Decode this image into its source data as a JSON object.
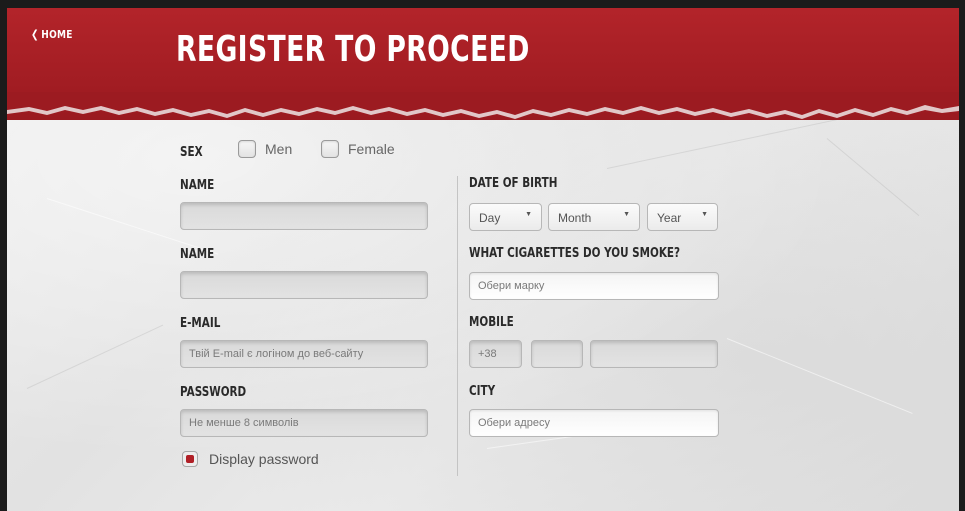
{
  "header": {
    "home_label": "HOME",
    "title": "REGISTER TO PROCEED"
  },
  "form": {
    "sex": {
      "label": "SEX",
      "options": [
        "Men",
        "Female"
      ]
    },
    "name_first": {
      "label": "NAME",
      "value": ""
    },
    "name_second": {
      "label": "NAME",
      "value": ""
    },
    "email": {
      "label": "E-MAIL",
      "placeholder": "Твій E-mail є логіном до веб-сайту"
    },
    "password": {
      "label": "PASSWORD",
      "placeholder": "Не менше 8 символів"
    },
    "show_password": {
      "label": "Display password",
      "checked": true
    },
    "dob": {
      "label": "DATE OF BIRTH",
      "day": "Day",
      "month": "Month",
      "year": "Year"
    },
    "cigarettes": {
      "label": "WHAT CIGARETTES DO YOU SMOKE?",
      "placeholder": "Обери марку"
    },
    "mobile": {
      "label": "MOBILE",
      "country_code": "+38"
    },
    "city": {
      "label": "CITY",
      "placeholder": "Обери адресу"
    }
  },
  "colors": {
    "brand_red": "#a51e24",
    "checkbox_red": "#b01f26",
    "paper": "#e6e6e6"
  },
  "icons": {
    "home": "chevron-left-icon",
    "select_caret": "caret-down-icon"
  }
}
